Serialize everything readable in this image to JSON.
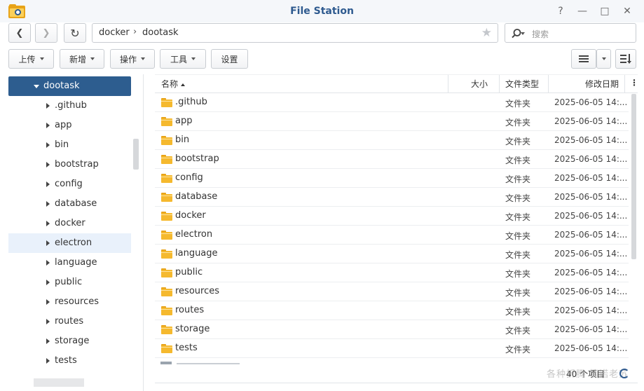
{
  "window": {
    "title": "File Station",
    "help_glyph": "?",
    "minimize_glyph": "—",
    "maximize_glyph": "□",
    "close_glyph": "✕",
    "icon": "file-station-icon"
  },
  "nav": {
    "back_glyph": "❮",
    "forward_glyph": "❯",
    "refresh_glyph": "↻",
    "path": [
      "docker",
      "dootask"
    ],
    "path_separator": "›",
    "favorite_glyph": "★",
    "search_placeholder": "搜索"
  },
  "toolbar": {
    "upload": "上传",
    "create": "新增",
    "action": "操作",
    "tools": "工具",
    "settings": "设置",
    "view_icon": "list-view-icon",
    "sort_icon": "sort-icon"
  },
  "sidebar": {
    "root": "dootask",
    "items": [
      ".github",
      "app",
      "bin",
      "bootstrap",
      "config",
      "database",
      "docker",
      "electron",
      "language",
      "public",
      "resources",
      "routes",
      "storage",
      "tests"
    ],
    "highlighted": "electron"
  },
  "columns": {
    "name": "名称",
    "size": "大小",
    "type": "文件类型",
    "modified": "修改日期"
  },
  "files": [
    {
      "name": ".github",
      "type": "文件夹",
      "date": "2025-06-05 14:..."
    },
    {
      "name": "app",
      "type": "文件夹",
      "date": "2025-06-05 14:..."
    },
    {
      "name": "bin",
      "type": "文件夹",
      "date": "2025-06-05 14:..."
    },
    {
      "name": "bootstrap",
      "type": "文件夹",
      "date": "2025-06-05 14:..."
    },
    {
      "name": "config",
      "type": "文件夹",
      "date": "2025-06-05 14:..."
    },
    {
      "name": "database",
      "type": "文件夹",
      "date": "2025-06-05 14:..."
    },
    {
      "name": "docker",
      "type": "文件夹",
      "date": "2025-06-05 14:..."
    },
    {
      "name": "electron",
      "type": "文件夹",
      "date": "2025-06-05 14:..."
    },
    {
      "name": "language",
      "type": "文件夹",
      "date": "2025-06-05 14:..."
    },
    {
      "name": "public",
      "type": "文件夹",
      "date": "2025-06-05 14:..."
    },
    {
      "name": "resources",
      "type": "文件夹",
      "date": "2025-06-05 14:..."
    },
    {
      "name": "routes",
      "type": "文件夹",
      "date": "2025-06-05 14:..."
    },
    {
      "name": "storage",
      "type": "文件夹",
      "date": "2025-06-05 14:..."
    },
    {
      "name": "tests",
      "type": "文件夹",
      "date": "2025-06-05 14:..."
    }
  ],
  "footer": {
    "item_count": "40 个项目",
    "watermark": "各种折腾·情诺老苏"
  },
  "colors": {
    "accent": "#2d5d8f",
    "folder": "#f5b92e",
    "selection": "#e9f1fb"
  }
}
